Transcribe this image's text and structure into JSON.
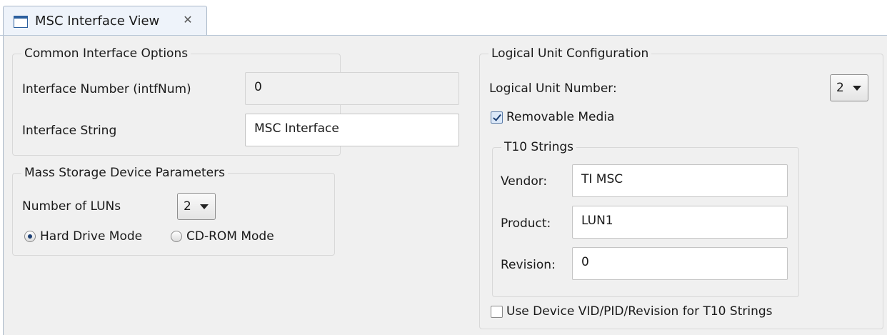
{
  "tab": {
    "title": "MSC Interface View",
    "close_glyph": "✕"
  },
  "common_interface_options": {
    "title": "Common Interface Options",
    "interface_number_label": "Interface Number (intfNum)",
    "interface_number_value": "0",
    "interface_string_label": "Interface String",
    "interface_string_value": "MSC Interface"
  },
  "mass_storage_device_parameters": {
    "title": "Mass Storage Device Parameters",
    "number_of_luns_label": "Number of LUNs",
    "number_of_luns_value": "2",
    "mode_options": [
      {
        "label": "Hard Drive Mode",
        "selected": true
      },
      {
        "label": "CD-ROM Mode",
        "selected": false
      }
    ]
  },
  "logical_unit_configuration": {
    "title": "Logical Unit Configuration",
    "logical_unit_number_label": "Logical Unit Number:",
    "logical_unit_number_value": "2",
    "removable_media_label": "Removable Media",
    "removable_media_checked": true,
    "t10_strings": {
      "title": "T10 Strings",
      "vendor_label": "Vendor:",
      "vendor_value": "TI MSC",
      "product_label": "Product:",
      "product_value": "LUN1",
      "revision_label": "Revision:",
      "revision_value": "0"
    },
    "use_device_vid_label": "Use Device VID/PID/Revision for T10 Strings",
    "use_device_vid_checked": false
  }
}
